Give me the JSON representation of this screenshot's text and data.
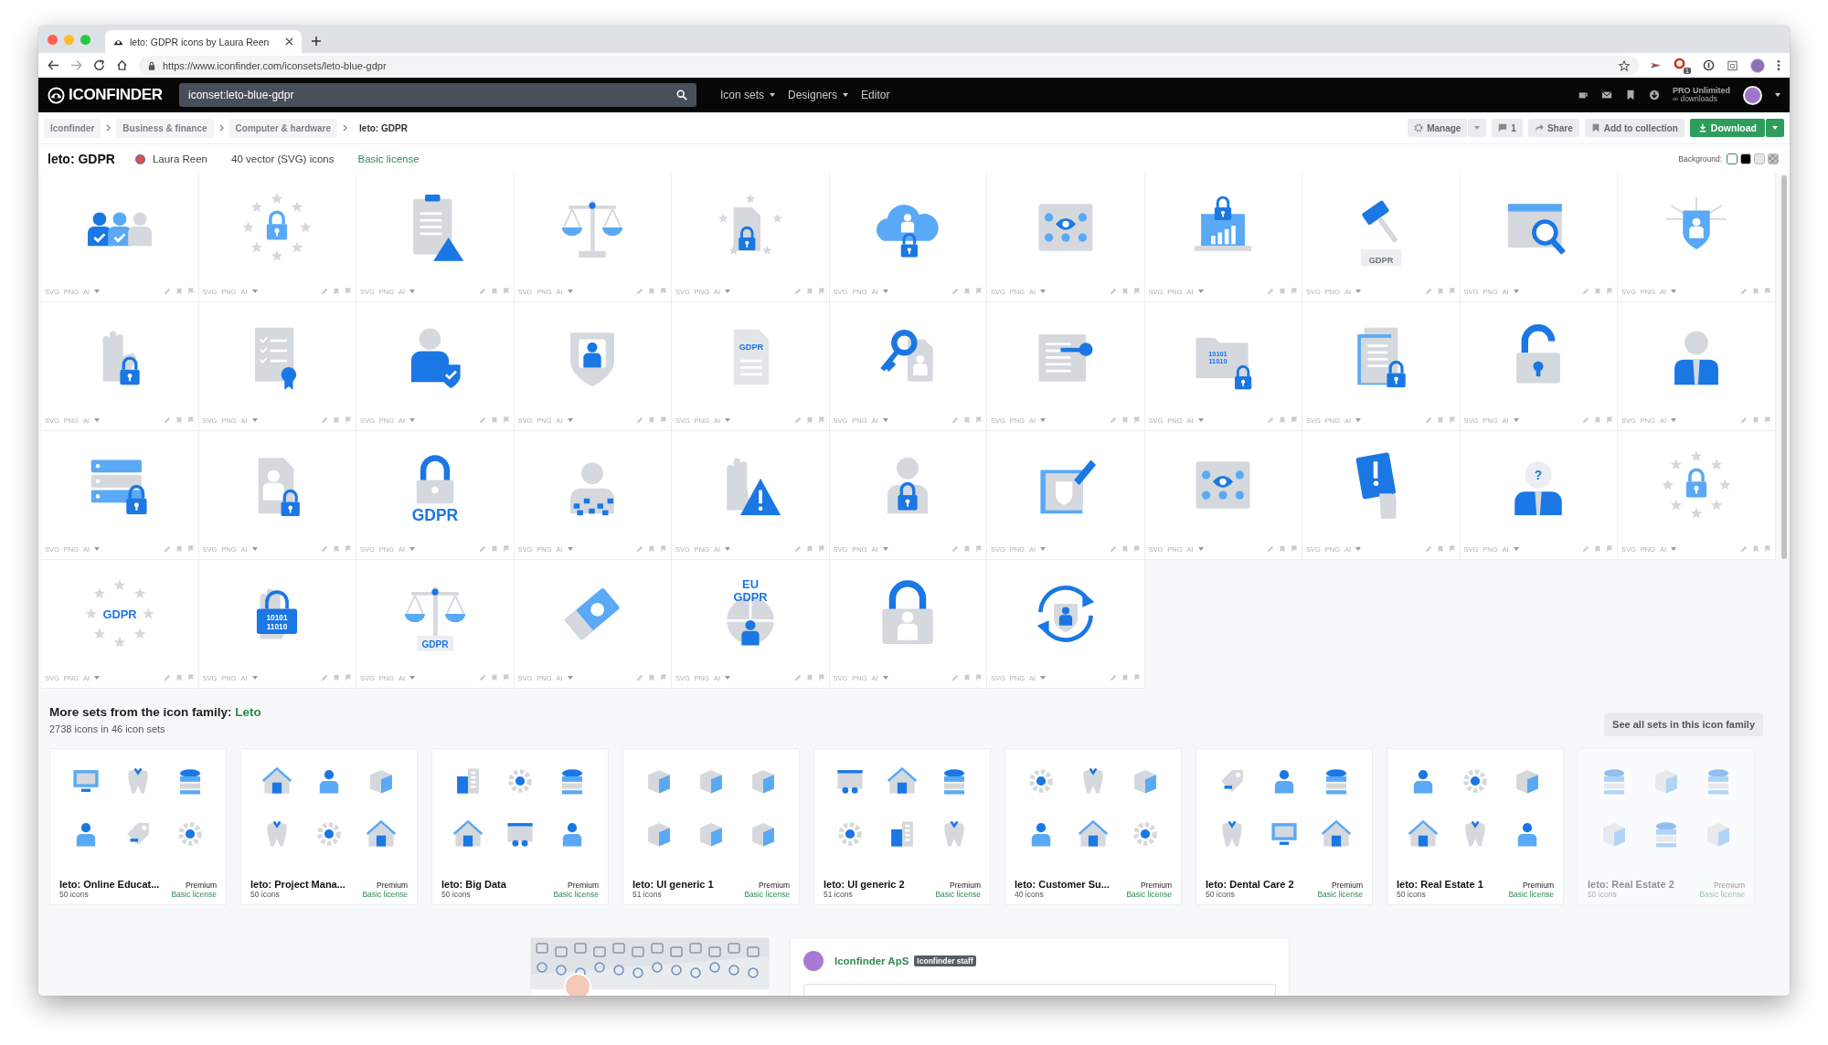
{
  "browser": {
    "tab": {
      "title": "leto: GDPR icons by Laura Reen"
    },
    "url": "https://www.iconfinder.com/iconsets/leto-blue-gdpr",
    "extension_badge": "1"
  },
  "header": {
    "logo": "ICONFINDER",
    "search": {
      "value": "iconset:leto-blue-gdpr"
    },
    "menu": [
      {
        "label": "Icon sets",
        "dropdown": true
      },
      {
        "label": "Designers",
        "dropdown": true
      },
      {
        "label": "Editor",
        "dropdown": false
      }
    ],
    "plan": "PRO Unlimited",
    "plan_detail": "∞ downloads"
  },
  "breadcrumbs": [
    {
      "label": "Iconfinder",
      "current": false
    },
    {
      "label": "Business & finance",
      "current": false
    },
    {
      "label": "Computer & hardware",
      "current": false
    },
    {
      "label": "leto: GDPR",
      "current": true
    }
  ],
  "actions": {
    "manage": "Manage",
    "comments": "1",
    "share": "Share",
    "add_to_collection": "Add to collection",
    "download": "Download"
  },
  "iconset": {
    "title": "leto: GDPR",
    "author": "Laura Reen",
    "count": "40 vector (SVG) icons",
    "license": "Basic license",
    "background_label": "Background:",
    "backgrounds": [
      {
        "kind": "solid",
        "color": "#ffffff",
        "selected": true
      },
      {
        "kind": "solid",
        "color": "#000000",
        "selected": false
      },
      {
        "kind": "solid",
        "color": "#e4e6ea",
        "selected": false
      },
      {
        "kind": "checker",
        "color": "#c4c4c4",
        "selected": false
      }
    ]
  },
  "icons": [
    {
      "formats": [
        "SVG",
        "PNG",
        "AI"
      ]
    },
    {
      "formats": [
        "SVG",
        "PNG",
        "AI"
      ]
    },
    {
      "formats": [
        "SVG",
        "PNG",
        "AI"
      ]
    },
    {
      "formats": [
        "SVG",
        "PNG",
        "AI"
      ]
    },
    {
      "formats": [
        "SVG",
        "PNG",
        "AI"
      ]
    },
    {
      "formats": [
        "SVG",
        "PNG",
        "AI"
      ]
    },
    {
      "formats": [
        "SVG",
        "PNG",
        "AI"
      ]
    },
    {
      "formats": [
        "SVG",
        "PNG",
        "AI"
      ]
    },
    {
      "formats": [
        "SVG",
        "PNG",
        "AI"
      ],
      "caption": [
        "GDPR"
      ]
    },
    {
      "formats": [
        "SVG",
        "PNG",
        "AI"
      ]
    },
    {
      "formats": [
        "SVG",
        "PNG",
        "AI"
      ]
    },
    {
      "formats": [
        "SVG",
        "PNG",
        "AI"
      ]
    },
    {
      "formats": [
        "SVG",
        "PNG",
        "AI"
      ]
    },
    {
      "formats": [
        "SVG",
        "PNG",
        "AI"
      ]
    },
    {
      "formats": [
        "SVG",
        "PNG",
        "AI"
      ]
    },
    {
      "formats": [
        "SVG",
        "PNG",
        "AI"
      ],
      "caption": [
        "GDPR"
      ]
    },
    {
      "formats": [
        "SVG",
        "PNG",
        "AI"
      ]
    },
    {
      "formats": [
        "SVG",
        "PNG",
        "AI"
      ]
    },
    {
      "formats": [
        "SVG",
        "PNG",
        "AI"
      ],
      "caption": [
        "10101",
        "11010"
      ]
    },
    {
      "formats": [
        "SVG",
        "PNG",
        "AI"
      ]
    },
    {
      "formats": [
        "SVG",
        "PNG",
        "AI"
      ]
    },
    {
      "formats": [
        "SVG",
        "PNG",
        "AI"
      ]
    },
    {
      "formats": [
        "SVG",
        "PNG",
        "AI"
      ]
    },
    {
      "formats": [
        "SVG",
        "PNG",
        "AI"
      ]
    },
    {
      "formats": [
        "SVG",
        "PNG",
        "AI"
      ],
      "caption": [
        "GDPR"
      ]
    },
    {
      "formats": [
        "SVG",
        "PNG",
        "AI"
      ]
    },
    {
      "formats": [
        "SVG",
        "PNG",
        "AI"
      ]
    },
    {
      "formats": [
        "SVG",
        "PNG",
        "AI"
      ]
    },
    {
      "formats": [
        "SVG",
        "PNG",
        "AI"
      ]
    },
    {
      "formats": [
        "SVG",
        "PNG",
        "AI"
      ]
    },
    {
      "formats": [
        "SVG",
        "PNG",
        "AI"
      ]
    },
    {
      "formats": [
        "SVG",
        "PNG",
        "AI"
      ],
      "caption": [
        "?"
      ]
    },
    {
      "formats": [
        "SVG",
        "PNG",
        "AI"
      ]
    },
    {
      "formats": [
        "SVG",
        "PNG",
        "AI"
      ],
      "caption": [
        "GDPR"
      ]
    },
    {
      "formats": [
        "SVG",
        "PNG",
        "AI"
      ],
      "caption": [
        "10101",
        "11010"
      ]
    },
    {
      "formats": [
        "SVG",
        "PNG",
        "AI"
      ],
      "caption": [
        "GDPR"
      ]
    },
    {
      "formats": [
        "SVG",
        "PNG",
        "AI"
      ]
    },
    {
      "formats": [
        "SVG",
        "PNG",
        "AI"
      ],
      "caption": [
        "EU",
        "GDPR"
      ]
    },
    {
      "formats": [
        "SVG",
        "PNG",
        "AI"
      ]
    },
    {
      "formats": [
        "SVG",
        "PNG",
        "AI"
      ]
    }
  ],
  "family": {
    "title": "More sets from the icon family:",
    "family_name": "Leto",
    "summary": "2738 icons in 46 icon sets",
    "see_all": "See all sets in this icon family",
    "sets": [
      {
        "title": "leto: Online Educat...",
        "tier": "Premium",
        "count": "50 icons",
        "license": "Basic license",
        "faded": false
      },
      {
        "title": "leto: Project Mana...",
        "tier": "Premium",
        "count": "50 icons",
        "license": "Basic license",
        "faded": false
      },
      {
        "title": "leto: Big Data",
        "tier": "Premium",
        "count": "50 icons",
        "license": "Basic license",
        "faded": false
      },
      {
        "title": "leto: UI generic 1",
        "tier": "Premium",
        "count": "51 icons",
        "license": "Basic license",
        "faded": false
      },
      {
        "title": "leto: UI generic 2",
        "tier": "Premium",
        "count": "51 icons",
        "license": "Basic license",
        "faded": false
      },
      {
        "title": "leto: Customer Su...",
        "tier": "Premium",
        "count": "40 icons",
        "license": "Basic license",
        "faded": false
      },
      {
        "title": "leto: Dental Care 2",
        "tier": "Premium",
        "count": "50 icons",
        "license": "Basic license",
        "faded": false
      },
      {
        "title": "leto: Real Estate 1",
        "tier": "Premium",
        "count": "50 icons",
        "license": "Basic license",
        "faded": false
      },
      {
        "title": "leto: Real Estate 2",
        "tier": "Premium",
        "count": "50 icons",
        "license": "Basic license",
        "faded": true
      }
    ]
  },
  "comments": {
    "author": "Iconfinder ApS",
    "badge": "Iconfinder staff"
  }
}
